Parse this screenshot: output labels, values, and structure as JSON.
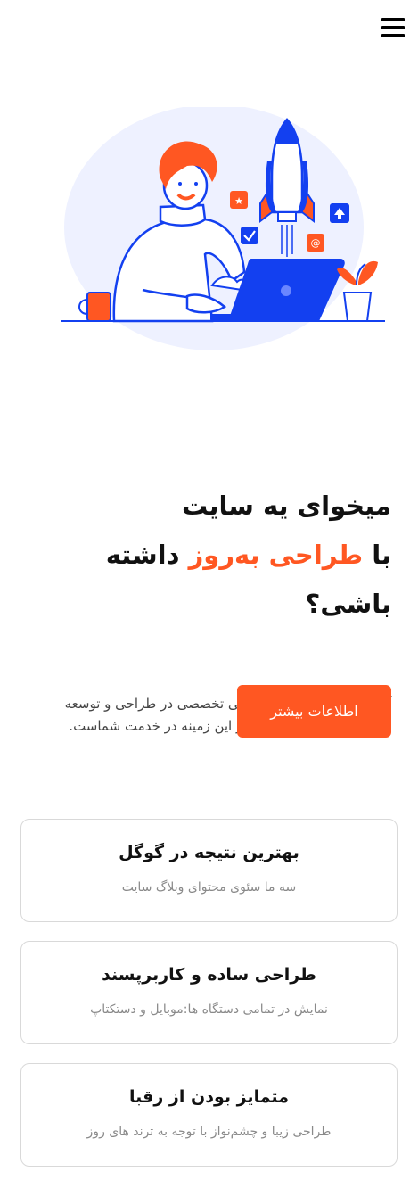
{
  "header": {
    "menu_icon": "hamburger-menu-icon"
  },
  "hero": {
    "illustration": "developer-with-laptop-and-rocket-illustration",
    "title_line1": "میخوای یه سایت",
    "title_line2_prefix": "با ",
    "title_line2_highlight": "طراحی به‌روز",
    "title_line2_suffix": " داشته باشی؟",
    "description": "آژانس طراحی به همراه تیمی تخصصی در طراحی و توسعه وب‌سایت با سال‌ها تجربه در این زمینه در خدمت شماست.",
    "cta_label": "اطلاعات بیشتر"
  },
  "features": [
    {
      "title": "بهترین نتیجه در گوگل",
      "description": "سه ما سئوی محتوای وبلاگ سایت"
    },
    {
      "title": "طراحی ساده و کاربرپسند",
      "description": "نمایش در تمامی دستگاه ها:موبایل و دستکتاپ"
    },
    {
      "title": "متمایز بودن از رقبا",
      "description": "طراحی زیبا و چشم‌نواز با توجه به ترند های روز"
    }
  ],
  "colors": {
    "accent": "#ff5722",
    "blue": "#1340f0",
    "blob": "#eef1ff",
    "text": "#111111",
    "muted": "#8a8a8a"
  }
}
